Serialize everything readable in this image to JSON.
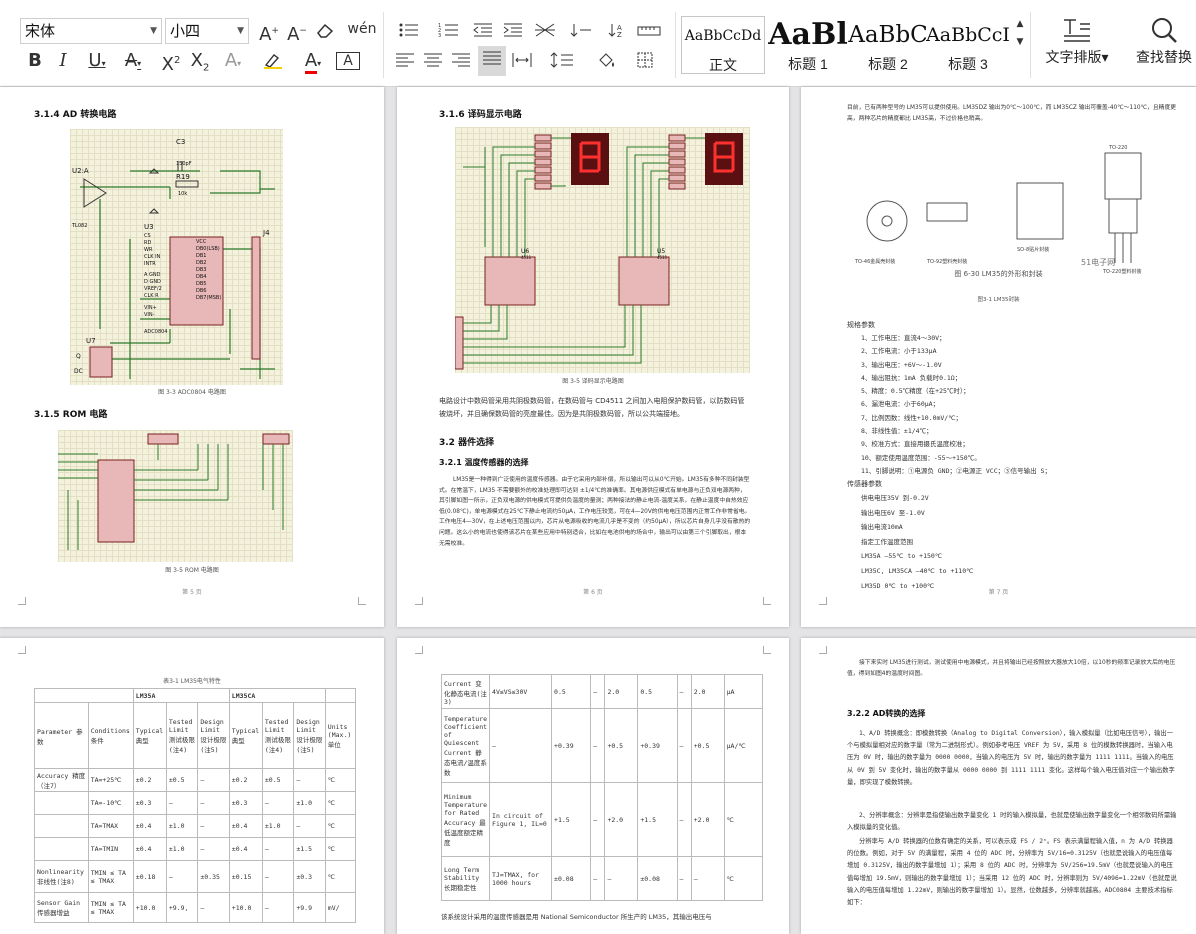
{
  "ribbon": {
    "font_name": "宋体",
    "font_size": "小四",
    "clear_icon": "eraser-icon",
    "wen_label": "wén",
    "styles": [
      {
        "preview": "AaBbCcDd",
        "name": "正文"
      },
      {
        "preview": "AaBl",
        "name": "标题 1"
      },
      {
        "preview": "AaBbC",
        "name": "标题 2"
      },
      {
        "preview": "AaBbCcI",
        "name": "标题 3"
      }
    ],
    "text_layout": "文字排版",
    "find_replace": "查找替换"
  },
  "p1": {
    "h1": "3.1.4 AD 转换电路",
    "c1": "图 3-3 ADC0804 电路图",
    "h2": "3.1.5 ROM 电路",
    "c2": "图 3-5 ROM 电路图",
    "pn": "第 5 页",
    "schematic1": {
      "c3": "C3",
      "c3v": "150pF",
      "r19": "R19",
      "r19v": "10k",
      "u2a": "U2:A",
      "u3": "U3",
      "u4": "J4",
      "u7": "U7",
      "tl082": "TL082",
      "chip": "ADC0804",
      "pins_left": [
        "CS",
        "RD",
        "WR",
        "CLK IN",
        "INTR",
        "A GND",
        "D GND",
        "VREF/2",
        "CLK R",
        "VIN+",
        "VIN-"
      ],
      "pins_right": [
        "VCC",
        "DB0(LSB)",
        "DB1",
        "DB2",
        "DB3",
        "DB4",
        "DB5",
        "DB6",
        "DB7(MSB)"
      ],
      "q": "Q",
      "dc": "DC"
    }
  },
  "p2": {
    "h1": "3.1.6 译码显示电路",
    "c1": "图 3-5 译码显示电路图",
    "u6": "U6",
    "u5": "U5",
    "ic": "4511",
    "para1": "电路设计中数码管采用共阴极数码管，在数码管与 CD4511 之间加入电阻保护数码管，以防数码管被烧坏，并且确保数码管的亮度最佳。因为是共阴极数码管，所以公共端接地。",
    "h2": "3.2 器件选择",
    "h3": "3.2.1 温度传感器的选择",
    "para2": "LM35是一种得到广泛使用的温度传感器。由于它采用内部补偿，所以输出可以从0℃开始。LM35有多种不同封装型式。在常温下，LM35 不需要额外的校准处理即可达到 ±1/4℃的准确率。其电源供应模式有单电源与正负双电源两种，其引脚如图一所示，正负双电源的供电模式可提供负温度的量测；两种接法的静止电流-温度关系，在静止温度中自热效应低(0.08℃)，单电源模式在25℃下静止电流约50μA，工作电压较宽，可在4—20V的供电电压范围内正常工作非常省电。工作电压4—30V，在上述电压范围以内，芯片从电源吸收的电流几乎是不变的（约50μA），所以芯片自身几乎没有散热的问题。这么小的电流也使得该芯片在某些应用中特别适合，比如在电池供电的场合中，输出可以由第三个引脚取出，根本无需校准。",
    "pn": "第 6 页"
  },
  "p3": {
    "top": "目前，已有两种型号的 LM35可以提供使用。LM35DZ 输出为0℃～100℃，而 LM35CZ 输出可覆盖-40℃～110℃，且精度更高，两种芯片的精度都比 LM35高，不过价格也稍高。",
    "fig": "图 6-30 LM35的外形和封装",
    "fig2": "图3-1 LM35封装",
    "to220": "TO-220",
    "wm": "51电子网",
    "pkg": [
      "TO-46金属壳封装",
      "TO-92塑料壳封装",
      "SO-8贴片封装",
      "TO-220塑料封装"
    ],
    "spec_title": "规格参数",
    "specs": [
      "1、工作电压：直流4～30V；",
      "2、工作电流：小于133μA",
      "3、输出电压：+6V～-1.0V",
      "4、输出阻抗：1mA 负载时0.1Ω；",
      "5、精度：0.5℃精度（在+25℃时）；",
      "6、漏泄电流：小于60μA；",
      "7、比例因数：线性+10.0mV/℃；",
      "8、非线性值：±1/4℃；",
      "9、校准方式：直接用摄氏温度校准；",
      "10、额定使用温度范围：-55～+150℃。",
      "11、引脚说明：①电源负 GND；②电源正 VCC；③信号输出 S；"
    ],
    "sensor_title": "传感器参数",
    "sensor": [
      "供电电压35V 到-0.2V",
      "输出电压6V 至-1.0V",
      "输出电流10mA",
      "指定工作温度范围",
      "LM35A –55℃ to +150℃",
      "LM35C, LM35CA –40℃ to +110℃",
      "LM35D 0℃ to +100℃"
    ],
    "pn": "第 7 页"
  },
  "p4": {
    "title": "表3-1 LM35电气特性",
    "h_lm35a": "LM35A",
    "h_lm35ca": "LM35CA",
    "hdr": [
      "Parameter 参数",
      "Conditions 条件",
      "Typical 典型",
      "Tested Limit 测试极限(注4)",
      "Design Limit 设计极限(注5)",
      "Typical 典型",
      "Tested Limit 测试极限(注4)",
      "Design Limit 设计极限(注5)",
      "Units (Max.) 单位"
    ],
    "rows": [
      [
        "Accuracy 精度（注7）",
        "TA=+25℃",
        "±0.2",
        "±0.5",
        "–",
        "±0.2",
        "±0.5",
        "–",
        "℃"
      ],
      [
        "",
        "TA=-10℃",
        "±0.3",
        "–",
        "–",
        "±0.3",
        "–",
        "±1.0",
        "℃"
      ],
      [
        "",
        "TA=TMAX",
        "±0.4",
        "±1.0",
        "–",
        "±0.4",
        "±1.0",
        "–",
        "℃"
      ],
      [
        "",
        "TA=TMIN",
        "±0.4",
        "±1.0",
        "–",
        "±0.4",
        "–",
        "±1.5",
        "℃"
      ],
      [
        "Nonlinearity 非线性(注8)",
        "TMIN ≤ TA ≤ TMAX",
        "±0.18",
        "–",
        "±0.35",
        "±0.15",
        "–",
        "±0.3",
        "℃"
      ],
      [
        "Sensor Gain 传感器增益",
        "TMIN ≤ TA ≤ TMAX",
        "+10.0",
        "+9.9,",
        "–",
        "+10.0",
        "–",
        "+9.9",
        "mV/"
      ]
    ]
  },
  "p5": {
    "rows": [
      [
        "Current 变化静态电流(注3)",
        "4V≤VS≤30V",
        "0.5",
        "–",
        "2.0",
        "0.5",
        "–",
        "2.0",
        "μA"
      ],
      [
        "Temperature Coefficient of Quiescent Current 静态电流/温度系数",
        "–",
        "+0.39",
        "–",
        "+0.5",
        "+0.39",
        "–",
        "+0.5",
        "μA/℃"
      ],
      [
        "Minimum Temperature for Rated Accuracy 最低温度额定精度",
        "In circuit of Figure 1, IL=0",
        "+1.5",
        "–",
        "+2.0",
        "+1.5",
        "–",
        "+2.0",
        "℃"
      ],
      [
        "Long Term Stability 长期稳定性",
        "TJ=TMAX, for 1000 hours",
        "±0.08",
        "–",
        "–",
        "±0.08",
        "–",
        "–",
        "℃"
      ]
    ],
    "bottom": "该系统设计采用的温度传感器是用 National Semiconductor 所生产的 LM35，其输出电压与"
  },
  "p6": {
    "top": "接下来实时 LM35进行测试，测试使用中电源模式，并且将输出已经按照放大器放大10倍，以10秒的频率记录放大后的电压值，得到如图4的温度时间图。",
    "h": "3.2.2 AD转换的选择",
    "p1": "1、A/D 转换概念：即模数转换（Analog to Digital Conversion），输入模拟量（比如电压信号），输出一个与模拟量相对应的数字量（常为二进制形式）。例如参考电压 VREF 为 5V，采用 8 位的模数转换器时，当输入电压为 0V 时，输出的数字量为 0000 0000，当输入的电压为 5V 时，输出的数字量为 1111 1111。当输入的电压从 0V 到 5V 变化时，输出的数字量从 0000 0000 到 1111 1111 变化。这样每个输入电压值对应一个输出数字量，即实现了模数转换。",
    "p2": "2、分辨率概念：分辨率是指使输出数字量变化 1 时的输入模拟量，也就是使输出数字量变化一个相邻数码所需输入模拟量的变化值。",
    "p3": "分辨率与 A/D 转换器的位数有确定的关系，可以表示成 FS / 2ⁿ。FS 表示满量程输入值，n 为 A/D 转换器的位数。例如，对于 5V 的满量程，采用 4 位的 ADC 时，分辨率为 5V/16=0.3125V（也就是说输入的电压值每增加 0.3125V，输出的数字量增加 1）；采用 8 位的 ADC 时，分辨率为 5V/256=19.5mV（也就是说输入的电压值每增加 19.5mV，则输出的数字量增加 1）；当采用 12 位的 ADC 时，分辨率则为 5V/4096=1.22mV（也就是说输入的电压值每增加 1.22mV，则输出的数字量增加 1）。显然，位数越多，分辨率就越高。ADC0804 主要技术指标如下："
  }
}
